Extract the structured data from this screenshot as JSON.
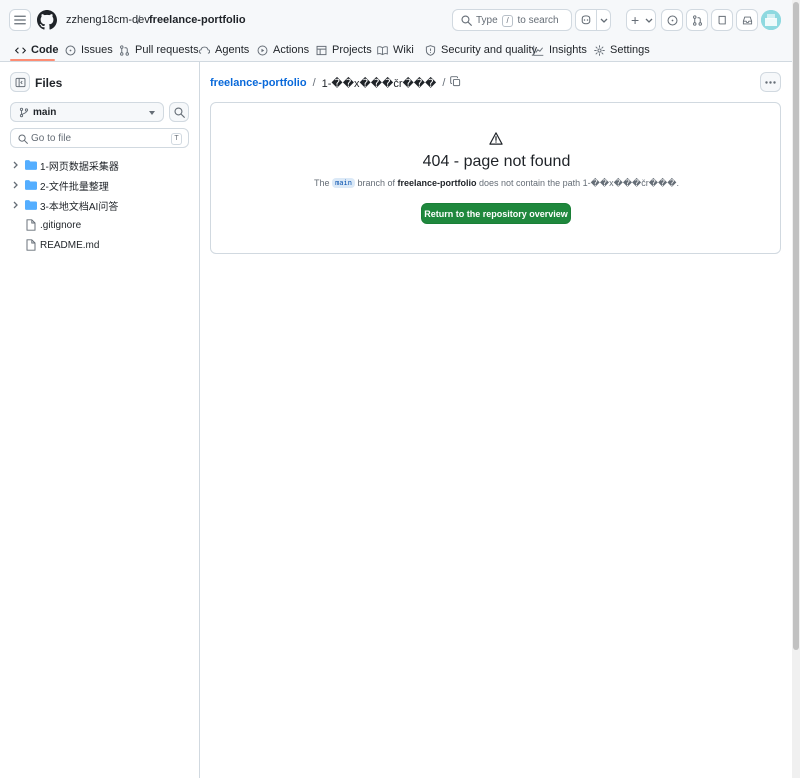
{
  "header": {
    "owner": "zzheng18cm-dev",
    "separator": "/",
    "repo": "freelance-portfolio",
    "search": {
      "prefix": "Type",
      "key": "/",
      "suffix": "to search"
    },
    "plus_label": "+"
  },
  "tabs": [
    {
      "label": "Code",
      "icon": "code-icon",
      "active": true
    },
    {
      "label": "Issues",
      "icon": "issue-icon"
    },
    {
      "label": "Pull requests",
      "icon": "pull-request-icon"
    },
    {
      "label": "Agents",
      "icon": "agents-icon"
    },
    {
      "label": "Actions",
      "icon": "play-icon"
    },
    {
      "label": "Projects",
      "icon": "table-icon"
    },
    {
      "label": "Wiki",
      "icon": "book-icon"
    },
    {
      "label": "Security and quality",
      "icon": "shield-icon"
    },
    {
      "label": "Insights",
      "icon": "graph-icon"
    },
    {
      "label": "Settings",
      "icon": "gear-icon"
    }
  ],
  "sidebar": {
    "title": "Files",
    "branch": "main",
    "goto_placeholder": "Go to file",
    "goto_key": "T",
    "items": [
      {
        "name": "1-网页数据采集器",
        "type": "folder"
      },
      {
        "name": "2-文件批量整理",
        "type": "folder"
      },
      {
        "name": "3-本地文档AI问答",
        "type": "folder"
      },
      {
        "name": ".gitignore",
        "type": "file"
      },
      {
        "name": "README.md",
        "type": "file"
      }
    ]
  },
  "breadcrumb": {
    "repo": "freelance-portfolio",
    "sep": "/",
    "path": "1-��x���čr���",
    "trailing": "/"
  },
  "error": {
    "title": "404 - page not found",
    "msg_the": "The",
    "branch": "main",
    "msg_branch_of": "branch of",
    "repo": "freelance-portfolio",
    "msg_contain": "does not contain the path",
    "path": "1-��x���čr���.",
    "button": "Return to the repository overview"
  },
  "colors": {
    "accent": "#0969da",
    "primary_button": "#1f883d",
    "tab_underline": "#fd8c73",
    "folder": "#54aeff"
  }
}
